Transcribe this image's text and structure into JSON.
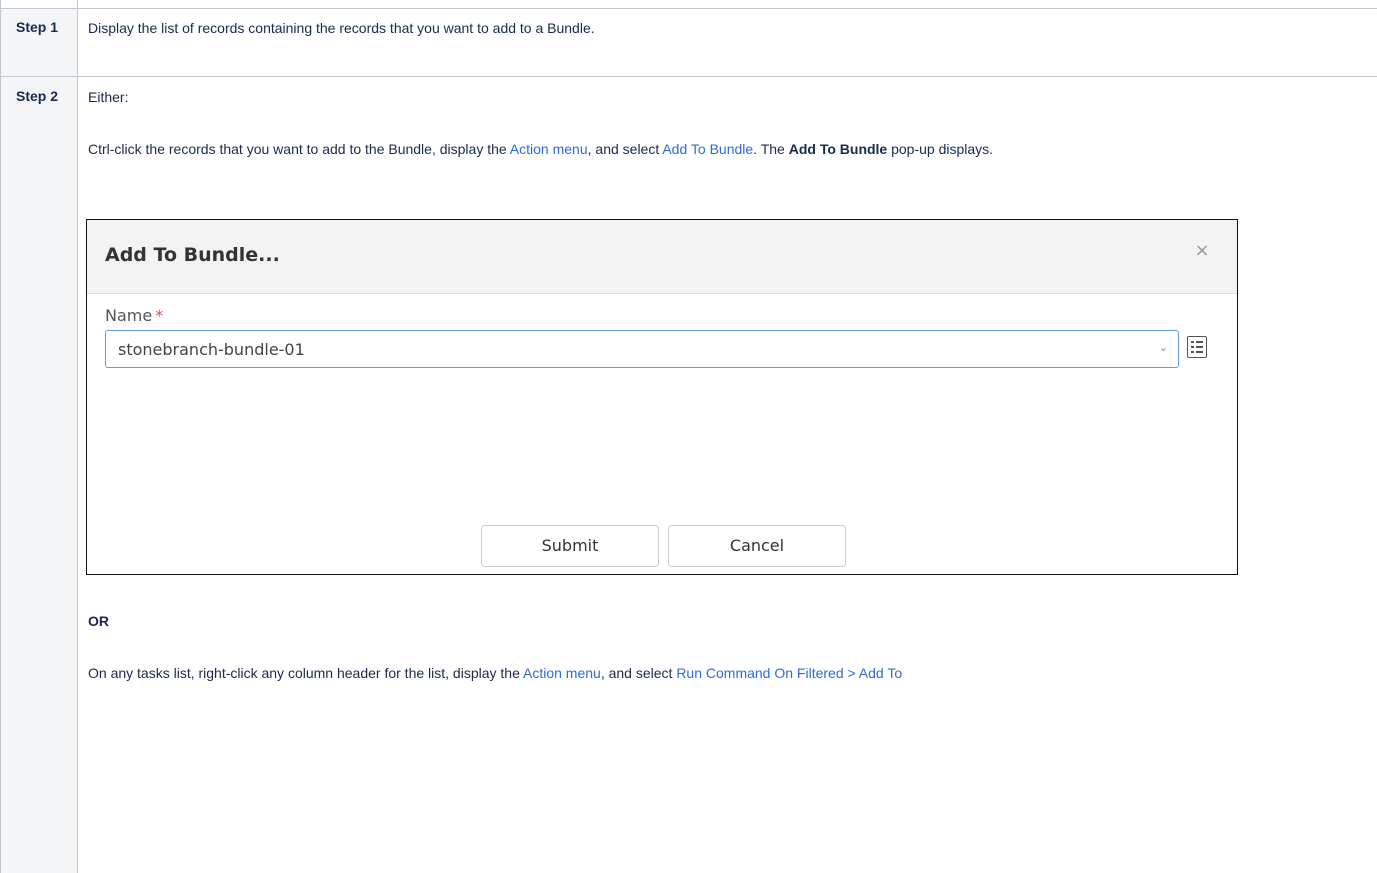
{
  "steps": [
    {
      "label": "Step 1",
      "content": "Display the list of records containing the records that you want to add to a Bundle."
    },
    {
      "label": "Step 2",
      "either": "Either:",
      "option1": {
        "prefix": "Ctrl-click the records that you want to add to the Bundle, display the ",
        "link1": "Action menu",
        "middle": ", and select ",
        "link2": "Add To Bundle",
        "dot": ". The ",
        "bold": "Add To Bundle",
        "suffix": " pop-up displays."
      },
      "or": "OR",
      "option2": {
        "prefix": "On any tasks list, right-click any column header for the list, display the ",
        "link1": "Action menu",
        "middle": ", and select ",
        "link2": "Run Command On Filtered > Add To"
      }
    }
  ],
  "dialog": {
    "title": "Add To Bundle...",
    "close": "×",
    "name_label": "Name",
    "required_mark": "*",
    "name_value": "stonebranch-bundle-01",
    "dropdown_arrow": "⌄",
    "submit": "Submit",
    "cancel": "Cancel"
  },
  "colors": {
    "link": "#2e6bd6",
    "step_bg": "#f4f5f7",
    "field_border": "#5b9bd5",
    "required": "#e05252"
  }
}
